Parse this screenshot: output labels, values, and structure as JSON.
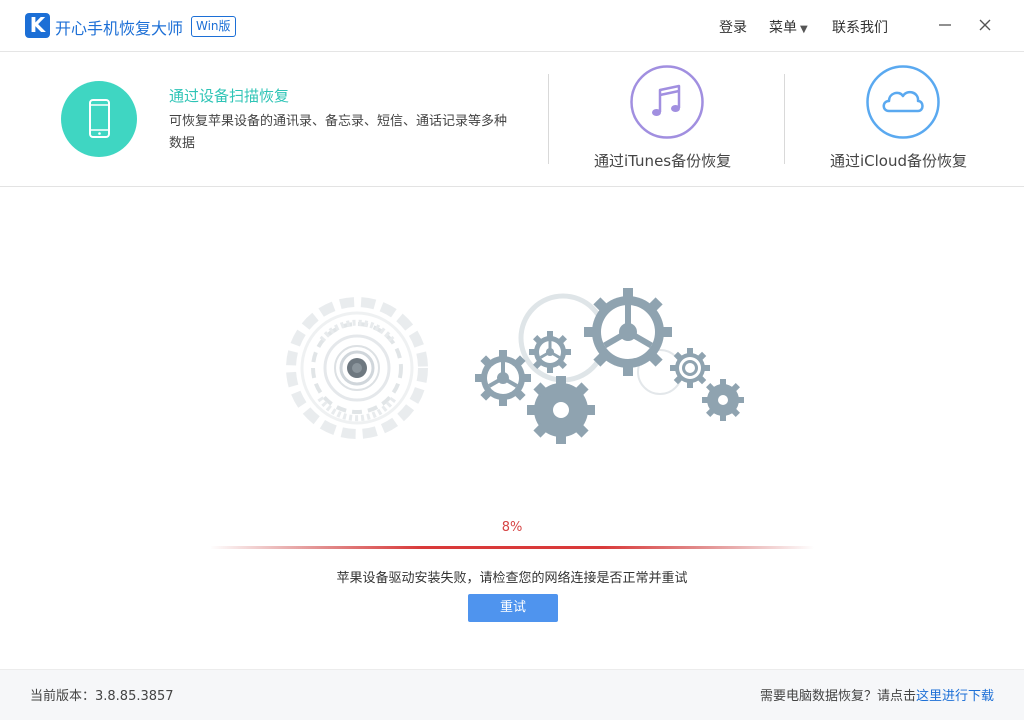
{
  "window": {
    "logo_letter": "K",
    "title": "开心手机恢复大师",
    "edition_badge": "Win版",
    "login": "登录",
    "menu": "菜单",
    "contact": "联系我们",
    "minimize_icon": "minimize-icon",
    "close_icon": "close-icon"
  },
  "modes": {
    "device_scan": {
      "title": "通过设备扫描恢复",
      "description": "可恢复苹果设备的通讯录、备忘录、短信、通话记录等多种数据",
      "icon": "phone-icon",
      "color": "#3fd6c2"
    },
    "itunes": {
      "label": "通过iTunes备份恢复",
      "icon": "music-note-icon",
      "color": "#a18fe0"
    },
    "icloud": {
      "label": "通过iCloud备份恢复",
      "icon": "cloud-icon",
      "color": "#5aa9f0"
    }
  },
  "progress": {
    "value": 0.08,
    "label": "8%",
    "color": "#d93a3a"
  },
  "status": {
    "error_message": "苹果设备驱动安装失败，请检查您的网络连接是否正常并重试",
    "retry_label": "重试"
  },
  "footer": {
    "version": "当前版本：3.8.85.3857",
    "prompt": "需要电脑数据恢复？请点击",
    "download_link": "这里进行下载"
  }
}
